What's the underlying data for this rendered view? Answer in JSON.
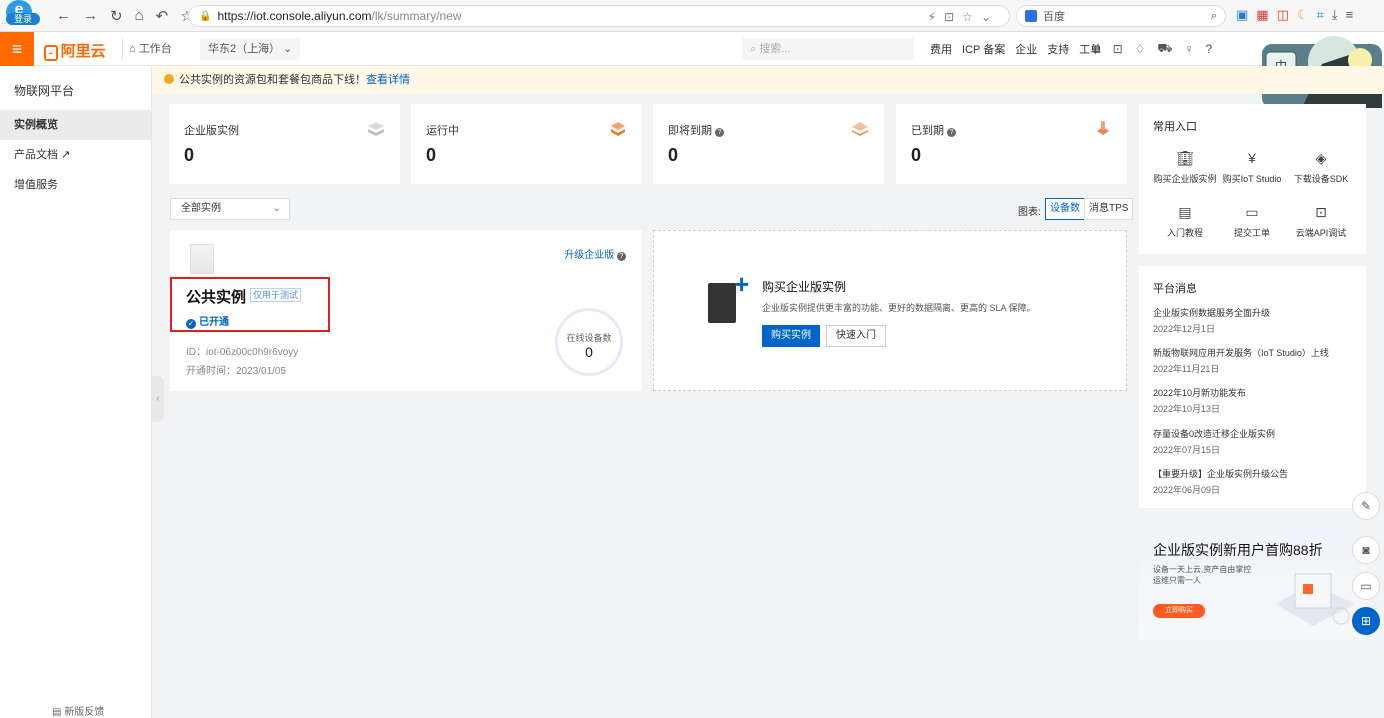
{
  "browser": {
    "login": "登录",
    "url_host": "https://iot.console.aliyun.com",
    "url_path": "/lk/summary/new",
    "search_engine": "百度"
  },
  "topnav": {
    "logo": "阿里云",
    "workbench": "工作台",
    "region": "华东2（上海）",
    "search_placeholder": "搜索...",
    "links": [
      "费用",
      "ICP 备案",
      "企业",
      "支持",
      "工单"
    ]
  },
  "notice": {
    "text": "公共实例的资源包和套餐包商品下线！",
    "link": "查看详情"
  },
  "sidebar": {
    "title": "物联网平台",
    "items": [
      {
        "label": "实例概览"
      },
      {
        "label": "产品文档 ↗"
      },
      {
        "label": "增值服务"
      }
    ],
    "feedback": "新版反馈"
  },
  "stats": [
    {
      "label": "企业版实例",
      "value": "0"
    },
    {
      "label": "运行中",
      "value": "0"
    },
    {
      "label": "即将到期",
      "value": "0"
    },
    {
      "label": "已到期",
      "value": "0"
    }
  ],
  "filter": {
    "selected": "全部实例"
  },
  "chart": {
    "label": "图表:",
    "tab1": "设备数",
    "tab2": "消息TPS"
  },
  "instance": {
    "upgrade": "升级企业版",
    "title": "公共实例",
    "tag": "仅用于测试",
    "status": "已开通",
    "id": "ID：iot-06z00c0h9r6voyy",
    "open_time": "开通时间：2023/01/05",
    "online_label": "在线设备数",
    "online_value": "0"
  },
  "buy": {
    "title": "购买企业版实例",
    "desc": "企业版实例提供更丰富的功能、更好的数据隔离、更高的 SLA 保障。",
    "primary": "购买实例",
    "secondary": "快速入门"
  },
  "entries": {
    "title": "常用入口",
    "items": [
      {
        "label": "购买企业版实例",
        "icon": "building-icon"
      },
      {
        "label": "购买IoT Studio",
        "icon": "yen-icon"
      },
      {
        "label": "下载设备SDK",
        "icon": "layers-icon"
      },
      {
        "label": "入门教程",
        "icon": "book-icon"
      },
      {
        "label": "提交工单",
        "icon": "ticket-icon"
      },
      {
        "label": "云端API调试",
        "icon": "terminal-icon"
      }
    ]
  },
  "messages": {
    "title": "平台消息",
    "items": [
      {
        "title": "企业版实例数据服务全面升级",
        "date": "2022年12月1日"
      },
      {
        "title": "新版物联网应用开发服务（IoT Studio）上线",
        "date": "2022年11月21日"
      },
      {
        "title": "2022年10月新功能发布",
        "date": "2022年10月13日"
      },
      {
        "title": "存量设备0改造迁移企业版实例",
        "date": "2022年07月15日"
      },
      {
        "title": "【重要升级】企业版实例升级公告",
        "date": "2022年06月09日"
      }
    ]
  },
  "promo": {
    "title": "企业版实例新用户首购88折",
    "line1": "设备一天上云,资产自由掌控",
    "line2": "运维只需一人",
    "button": "立即购买"
  },
  "colors": {
    "brand": "#ff6a00",
    "primary": "#0064c8",
    "highlight": "#e02020"
  }
}
